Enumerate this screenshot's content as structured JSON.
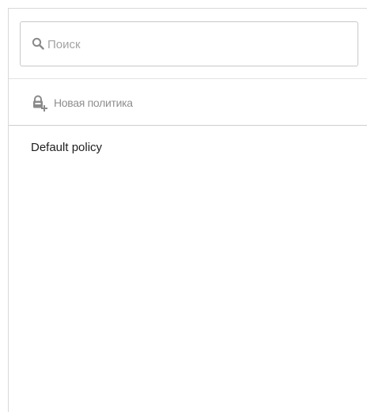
{
  "search": {
    "placeholder": "Поиск",
    "value": ""
  },
  "toolbar": {
    "new_policy_label": "Новая политика"
  },
  "policies": [
    {
      "label": "Default policy"
    }
  ],
  "icons": {
    "search": "search-icon",
    "new_policy": "new-policy-icon"
  },
  "colors": {
    "icon_gray": "#8a8a8a",
    "placeholder": "#a3a3a3",
    "text": "#1f1f1f",
    "border": "#c8c8c8"
  }
}
